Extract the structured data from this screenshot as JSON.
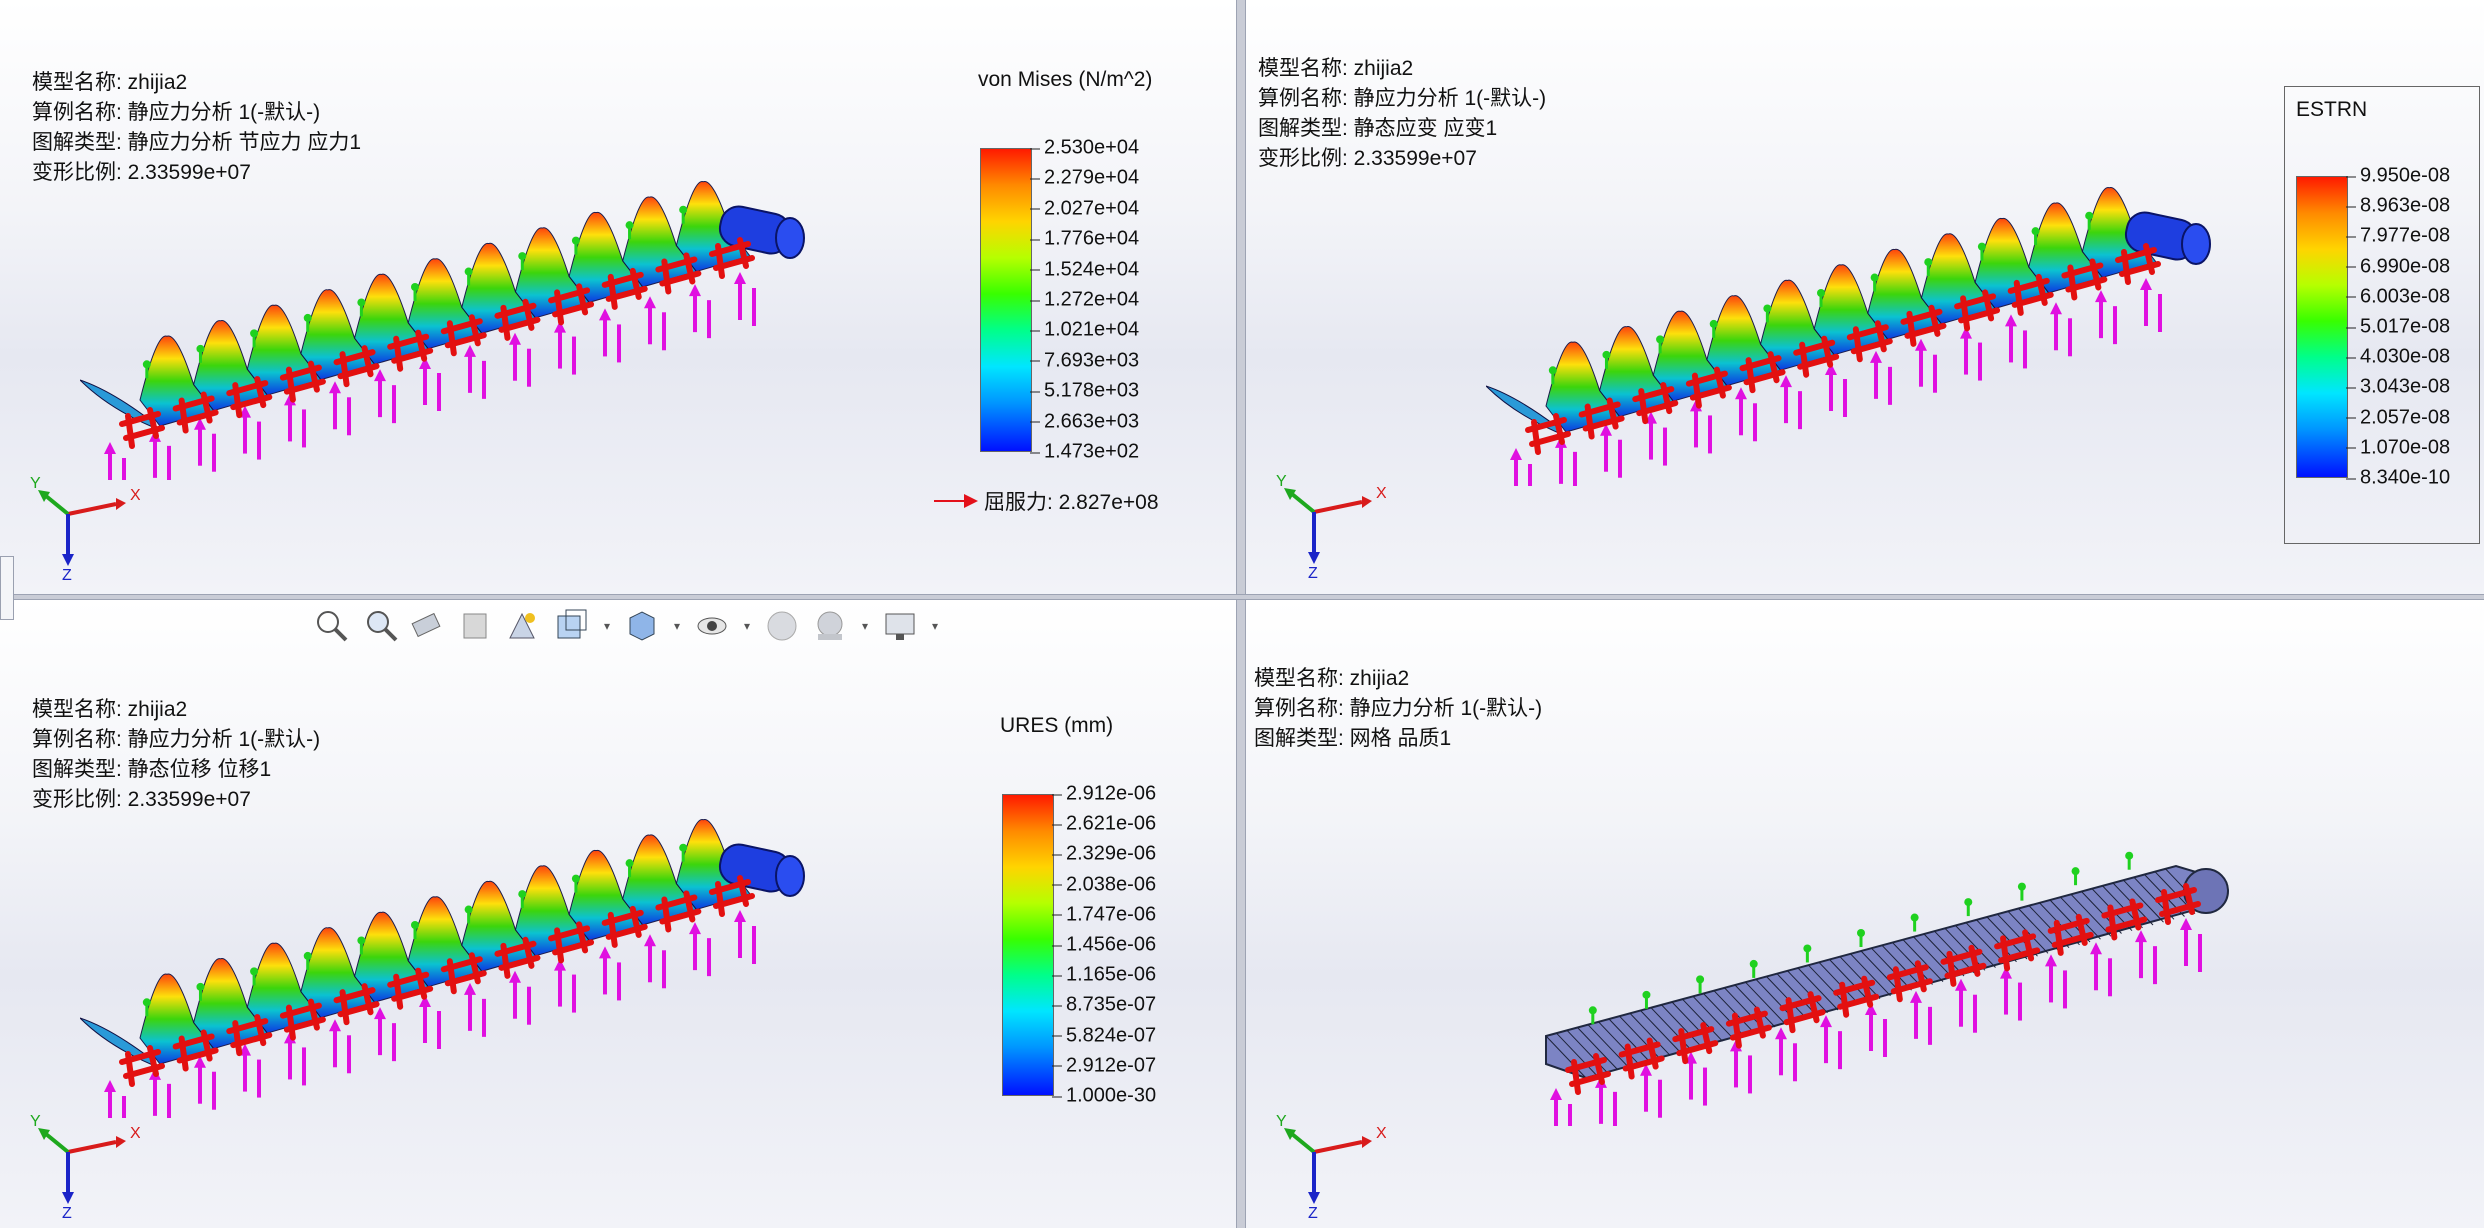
{
  "viewports": {
    "top_left": {
      "info": [
        "模型名称: zhijia2",
        "算例名称: 静应力分析 1(-默认-)",
        "图解类型: 静应力分析 节应力 应力1",
        "变形比例: 2.33599e+07"
      ],
      "legend_title": "von Mises (N/m^2)",
      "ticks": [
        "2.530e+04",
        "2.279e+04",
        "2.027e+04",
        "1.776e+04",
        "1.524e+04",
        "1.272e+04",
        "1.021e+04",
        "7.693e+03",
        "5.178e+03",
        "2.663e+03",
        "1.473e+02"
      ],
      "yield_label": "屈服力: 2.827e+08"
    },
    "top_right": {
      "info": [
        "模型名称: zhijia2",
        "算例名称: 静应力分析 1(-默认-)",
        "图解类型: 静态应变 应变1",
        "变形比例: 2.33599e+07"
      ],
      "legend_title": "ESTRN",
      "ticks": [
        "9.950e-08",
        "8.963e-08",
        "7.977e-08",
        "6.990e-08",
        "6.003e-08",
        "5.017e-08",
        "4.030e-08",
        "3.043e-08",
        "2.057e-08",
        "1.070e-08",
        "8.340e-10"
      ]
    },
    "bottom_left": {
      "info": [
        "模型名称: zhijia2",
        "算例名称: 静应力分析 1(-默认-)",
        "图解类型: 静态位移 位移1",
        "变形比例: 2.33599e+07"
      ],
      "legend_title": "URES (mm)",
      "ticks": [
        "2.912e-06",
        "2.621e-06",
        "2.329e-06",
        "2.038e-06",
        "1.747e-06",
        "1.456e-06",
        "1.165e-06",
        "8.735e-07",
        "5.824e-07",
        "2.912e-07",
        "1.000e-30"
      ]
    },
    "bottom_right": {
      "info": [
        "模型名称: zhijia2",
        "算例名称: 静应力分析 1(-默认-)",
        "图解类型: 网格 品质1"
      ]
    }
  },
  "triad_axes": {
    "x": "X",
    "y": "Y",
    "z": "Z"
  },
  "toolbar_icons": [
    "zoom-to-fit-icon",
    "zoom-to-area-icon",
    "previous-view-icon",
    "section-view-icon",
    "dynamic-annotation-icon",
    "view-orientation-icon",
    "display-style-icon",
    "hide-show-items-icon",
    "edit-appearance-icon",
    "apply-scene-icon",
    "view-settings-icon"
  ],
  "colors": {
    "fixture": "#1fd11f",
    "load_arrow": "#e010e0",
    "support": "#e31010",
    "yield_arrow": "#e3101a"
  }
}
